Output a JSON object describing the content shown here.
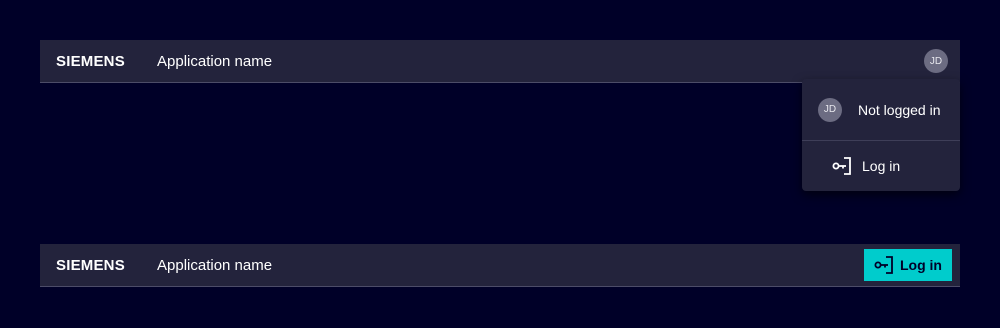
{
  "top_bar": {
    "brand": "SIEMENS",
    "app_name": "Application name",
    "avatar_initials": "JD"
  },
  "user_menu": {
    "avatar_initials": "JD",
    "status": "Not logged in",
    "login_label": "Log in",
    "login_icon": "login-icon"
  },
  "bottom_bar": {
    "brand": "SIEMENS",
    "app_name": "Application name",
    "login_label": "Log in",
    "login_icon": "login-icon"
  },
  "colors": {
    "background": "#000028",
    "bar": "#23233c",
    "accent": "#00cccc",
    "avatar": "#6c6c82"
  }
}
